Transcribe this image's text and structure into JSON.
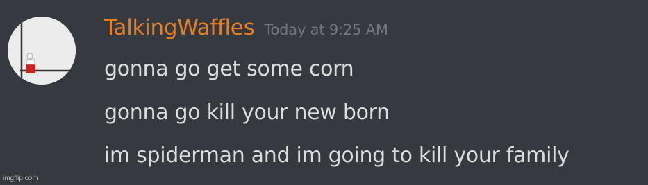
{
  "message": {
    "author": {
      "name": "TalkingWaffles",
      "name_color": "#e67e22",
      "avatar": "avatar-icon"
    },
    "timestamp": "Today at 9:25 AM",
    "lines": [
      "gonna go get some corn",
      "gonna go kill your new born",
      "im spiderman and im going to kill your family"
    ]
  },
  "watermark": "imgflip.com",
  "colors": {
    "background": "#36393f",
    "text": "#dcddde",
    "timestamp": "#72767d"
  }
}
